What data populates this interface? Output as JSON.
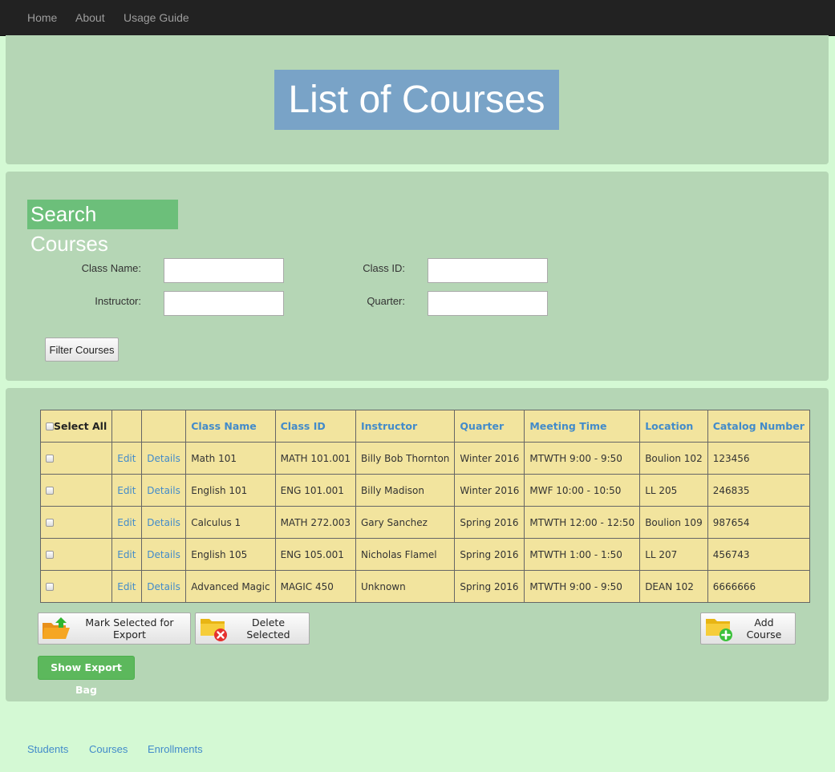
{
  "nav": {
    "items": [
      "Home",
      "About",
      "Usage Guide"
    ]
  },
  "header": {
    "title": "List of Courses"
  },
  "search": {
    "title": "Search Courses",
    "fields": [
      {
        "label": "Class Name:",
        "value": ""
      },
      {
        "label": "Class ID:",
        "value": ""
      },
      {
        "label": "Instructor:",
        "value": ""
      },
      {
        "label": "Quarter:",
        "value": ""
      }
    ],
    "filter_label": "Filter Courses"
  },
  "table": {
    "select_all": "Select All",
    "columns": [
      "Class Name",
      "Class ID",
      "Instructor",
      "Quarter",
      "Meeting Time",
      "Location",
      "Catalog Number"
    ],
    "edit_label": "Edit",
    "details_label": "Details",
    "rows": [
      [
        "Math 101",
        "MATH 101.001",
        "Billy Bob Thornton",
        "Winter 2016",
        "MTWTH 9:00 - 9:50",
        "Boulion 102",
        "123456"
      ],
      [
        "English 101",
        "ENG 101.001",
        "Billy Madison",
        "Winter 2016",
        "MWF 10:00 - 10:50",
        "LL 205",
        "246835"
      ],
      [
        "Calculus 1",
        "MATH 272.003",
        "Gary Sanchez",
        "Spring 2016",
        "MTWTH 12:00 - 12:50",
        "Boulion 109",
        "987654"
      ],
      [
        "English 105",
        "ENG 105.001",
        "Nicholas Flamel",
        "Spring 2016",
        "MTWTH 1:00 - 1:50",
        "LL 207",
        "456743"
      ],
      [
        "Advanced Magic",
        "MAGIC 450",
        "Unknown",
        "Spring 2016",
        "MTWTH 9:00 - 9:50",
        "DEAN 102",
        "6666666"
      ]
    ]
  },
  "actions": {
    "mark_export": "Mark Selected for Export",
    "delete_selected": "Delete Selected",
    "add_course": "Add Course",
    "show_export_bag": "Show Export Bag"
  },
  "footer": {
    "links": [
      "Students",
      "Courses",
      "Enrollments"
    ]
  },
  "colors": {
    "background": "#d4f9d4",
    "panel": "#b5d6b5",
    "title_bg": "#79a3c7",
    "search_title_bg": "#6cbf7a",
    "table_bg": "#f2e49e",
    "link": "#428bca",
    "success": "#5cb85c"
  }
}
